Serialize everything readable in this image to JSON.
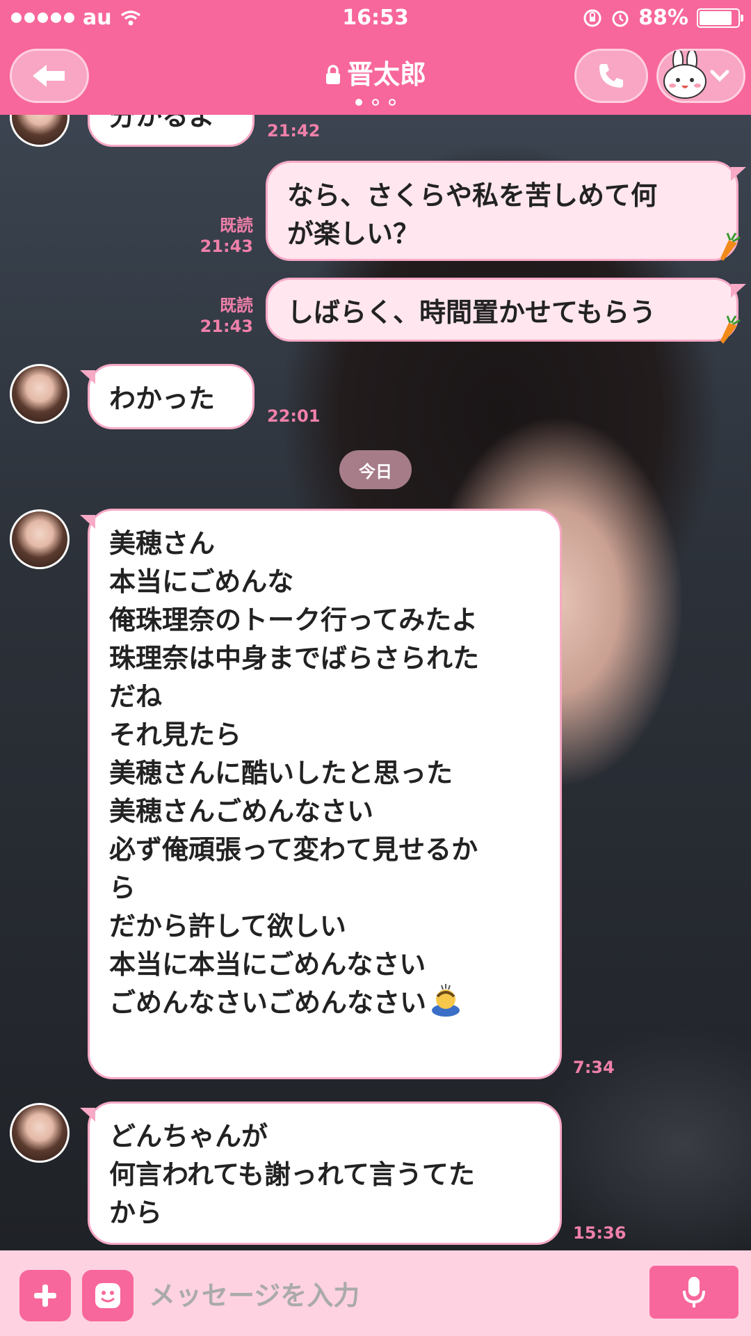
{
  "status_bar": {
    "carrier": "au",
    "time": "16:53",
    "battery": "88%",
    "battery_level": 0.88
  },
  "header": {
    "title": "晋太郎",
    "page_count": 3,
    "active_page": 1
  },
  "messages": [
    {
      "id": "m0",
      "direction": "received",
      "lines": [
        "分かるよ"
      ],
      "time": "21:42"
    },
    {
      "id": "m1",
      "direction": "sent",
      "lines": [
        "なら、さくらや私を苦しめて何",
        "が楽しい？"
      ],
      "read_label": "既読",
      "time": "21:43"
    },
    {
      "id": "m2",
      "direction": "sent",
      "lines": [
        "しばらく、時間置かせてもらう"
      ],
      "read_label": "既読",
      "time": "21:43"
    },
    {
      "id": "m3",
      "direction": "received",
      "lines": [
        "わかった"
      ],
      "time": "22:01"
    },
    {
      "id": "m4",
      "direction": "received",
      "lines": [
        "美穂さん",
        "本当にごめんな",
        "俺珠理奈のトーク行ってみたよ",
        "珠理奈は中身までばらさられた",
        "だね",
        "それ見たら",
        "美穂さんに酷いしたと思った",
        "美穂さんごめんなさい",
        "必ず俺頑張って変わて見せるか",
        "ら",
        "だから許して欲しい",
        "本当に本当にごめんなさい",
        "ごめんなさいごめんなさい"
      ],
      "time": "7:34"
    },
    {
      "id": "m5",
      "direction": "received",
      "lines": [
        "どんちゃんが",
        "何言われても謝っれて言うてた",
        "から"
      ],
      "time": "15:36"
    }
  ],
  "date_separator": "今日",
  "input_bar": {
    "placeholder": "メッセージを入力"
  },
  "icons": {
    "back": "back-arrow-icon",
    "call": "phone-icon",
    "friend": "bunny-sticker-icon",
    "plus": "plus-icon",
    "sticker": "smiley-icon",
    "mic": "microphone-icon",
    "wifi": "wifi-icon",
    "alarm": "alarm-icon",
    "rotation_lock": "rotation-lock-icon",
    "lock": "lock-icon",
    "carrot": "carrot-icon",
    "bowing_emoji": "bowing-person-emoji"
  },
  "colors": {
    "accent": "#f7679b",
    "bubble_border": "#f7a9c6",
    "meta_text": "#f080aa",
    "input_bar_bg": "#ffd2e2"
  }
}
